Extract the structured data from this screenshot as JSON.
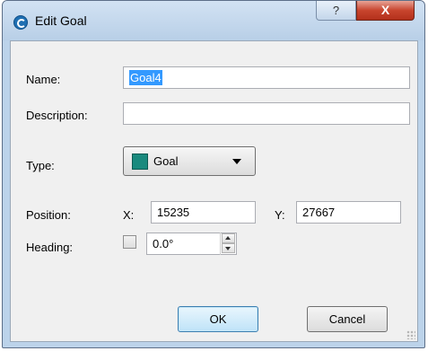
{
  "window": {
    "title": "Edit Goal",
    "help_label": "?",
    "close_label": "X"
  },
  "form": {
    "name_label": "Name:",
    "name_value": "Goal4",
    "description_label": "Description:",
    "description_value": "",
    "type_label": "Type:",
    "type_value": "Goal",
    "type_color": "#1a8a7e",
    "position_label": "Position:",
    "x_label": "X:",
    "x_value": "15235",
    "y_label": "Y:",
    "y_value": "27667",
    "heading_label": "Heading:",
    "heading_checked": false,
    "heading_value": "0.0°"
  },
  "buttons": {
    "ok_label": "OK",
    "cancel_label": "Cancel"
  },
  "colors": {
    "accent": "#3399ff",
    "close_red": "#c8452e"
  }
}
